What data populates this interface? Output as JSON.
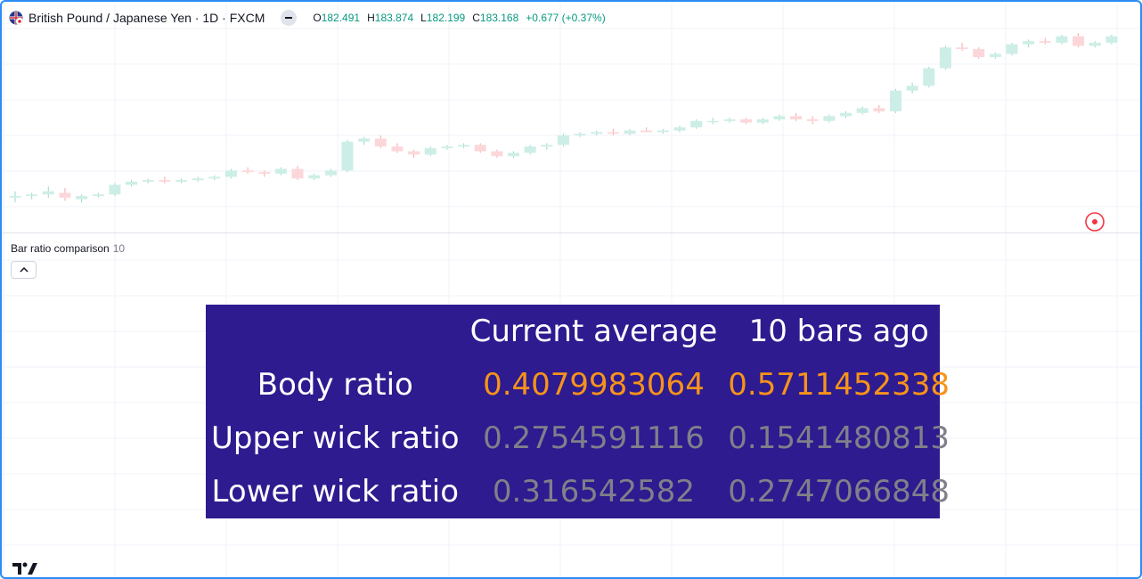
{
  "symbol": {
    "title": "British Pound / Japanese Yen · 1D · FXCM",
    "flag_icon": "gbp-jpy-flag-icon"
  },
  "ohlc": {
    "o_label": "O",
    "o_value": "182.491",
    "h_label": "H",
    "h_value": "183.874",
    "l_label": "L",
    "l_value": "182.199",
    "c_label": "C",
    "c_value": "183.168",
    "change": "+0.677 (+0.37%)"
  },
  "indicator": {
    "name": "Bar ratio comparison",
    "argument": "10"
  },
  "table": {
    "header": [
      "",
      "Current average",
      "10 bars ago"
    ],
    "rows": [
      {
        "label": "Body ratio",
        "current": "0.4079983064",
        "past": "0.5711452338"
      },
      {
        "label": "Upper wick ratio",
        "current": "0.2754591116",
        "past": "0.1541480813"
      },
      {
        "label": "Lower wick ratio",
        "current": "0.316542582",
        "past": "0.2747066848"
      }
    ]
  },
  "colors": {
    "up": "#cdeee6",
    "down": "#fcd7d9",
    "table_bg": "#2d1b8f",
    "highlight": "#f7931a",
    "muted": "#80808a",
    "accent": "#2a8df5",
    "alert": "#f23645"
  },
  "chart_data": {
    "type": "candlestick",
    "series": [
      {
        "name": "GBPJPY",
        "ohlc": [
          [
            168.9,
            169.3,
            168.6,
            169.0
          ],
          [
            169.0,
            169.2,
            168.8,
            169.1
          ],
          [
            169.1,
            169.6,
            168.9,
            169.3
          ],
          [
            169.2,
            169.5,
            168.7,
            168.9
          ],
          [
            168.8,
            169.1,
            168.6,
            169.0
          ],
          [
            169.0,
            169.2,
            168.9,
            169.1
          ],
          [
            169.1,
            169.8,
            169.0,
            169.7
          ],
          [
            169.7,
            170.0,
            169.6,
            169.9
          ],
          [
            169.9,
            170.1,
            169.8,
            170.0
          ],
          [
            170.0,
            170.2,
            169.8,
            169.9
          ],
          [
            169.9,
            170.1,
            169.8,
            170.0
          ],
          [
            170.0,
            170.2,
            169.9,
            170.1
          ],
          [
            170.1,
            170.3,
            170.0,
            170.2
          ],
          [
            170.2,
            170.7,
            170.1,
            170.6
          ],
          [
            170.6,
            170.8,
            170.4,
            170.5
          ],
          [
            170.5,
            170.6,
            170.2,
            170.4
          ],
          [
            170.4,
            170.8,
            170.3,
            170.7
          ],
          [
            170.7,
            170.9,
            170.0,
            170.1
          ],
          [
            170.1,
            170.4,
            170.0,
            170.3
          ],
          [
            170.3,
            170.7,
            170.2,
            170.6
          ],
          [
            170.6,
            172.5,
            170.5,
            172.4
          ],
          [
            172.4,
            172.7,
            172.2,
            172.6
          ],
          [
            172.6,
            172.8,
            172.0,
            172.1
          ],
          [
            172.1,
            172.3,
            171.7,
            171.8
          ],
          [
            171.8,
            171.9,
            171.4,
            171.6
          ],
          [
            171.6,
            172.1,
            171.5,
            172.0
          ],
          [
            172.0,
            172.2,
            171.9,
            172.1
          ],
          [
            172.1,
            172.3,
            172.0,
            172.2
          ],
          [
            172.2,
            172.3,
            171.7,
            171.8
          ],
          [
            171.8,
            171.9,
            171.4,
            171.5
          ],
          [
            171.5,
            171.8,
            171.4,
            171.7
          ],
          [
            171.7,
            172.2,
            171.6,
            172.1
          ],
          [
            172.1,
            172.3,
            171.9,
            172.2
          ],
          [
            172.2,
            172.9,
            172.1,
            172.8
          ],
          [
            172.8,
            173.0,
            172.7,
            172.9
          ],
          [
            172.9,
            173.1,
            172.8,
            173.0
          ],
          [
            173.0,
            173.2,
            172.8,
            172.9
          ],
          [
            172.9,
            173.2,
            172.8,
            173.1
          ],
          [
            173.1,
            173.3,
            173.0,
            173.0
          ],
          [
            173.0,
            173.2,
            172.9,
            173.1
          ],
          [
            173.1,
            173.4,
            173.0,
            173.3
          ],
          [
            173.3,
            173.8,
            173.2,
            173.7
          ],
          [
            173.7,
            173.9,
            173.5,
            173.7
          ],
          [
            173.7,
            173.9,
            173.6,
            173.8
          ],
          [
            173.8,
            173.9,
            173.5,
            173.6
          ],
          [
            173.6,
            173.9,
            173.5,
            173.8
          ],
          [
            173.8,
            174.1,
            173.7,
            174.0
          ],
          [
            174.0,
            174.2,
            173.7,
            173.8
          ],
          [
            173.8,
            174.0,
            173.5,
            173.7
          ],
          [
            173.7,
            174.1,
            173.6,
            174.0
          ],
          [
            174.0,
            174.3,
            173.9,
            174.2
          ],
          [
            174.2,
            174.6,
            174.1,
            174.5
          ],
          [
            174.5,
            174.7,
            174.2,
            174.3
          ],
          [
            174.3,
            175.7,
            174.2,
            175.6
          ],
          [
            175.6,
            176.1,
            175.4,
            175.9
          ],
          [
            175.9,
            177.1,
            175.8,
            177.0
          ],
          [
            177.0,
            178.4,
            176.9,
            178.3
          ],
          [
            178.3,
            178.6,
            178.1,
            178.2
          ],
          [
            178.2,
            178.3,
            177.6,
            177.7
          ],
          [
            177.7,
            178.0,
            177.6,
            177.9
          ],
          [
            177.9,
            178.6,
            177.8,
            178.5
          ],
          [
            178.5,
            178.8,
            178.3,
            178.7
          ],
          [
            178.7,
            178.9,
            178.5,
            178.6
          ],
          [
            178.6,
            179.1,
            178.5,
            179.0
          ],
          [
            179.0,
            179.2,
            178.3,
            178.4
          ],
          [
            178.4,
            178.7,
            178.3,
            178.6
          ],
          [
            178.6,
            179.1,
            178.5,
            179.0
          ]
        ]
      }
    ]
  }
}
